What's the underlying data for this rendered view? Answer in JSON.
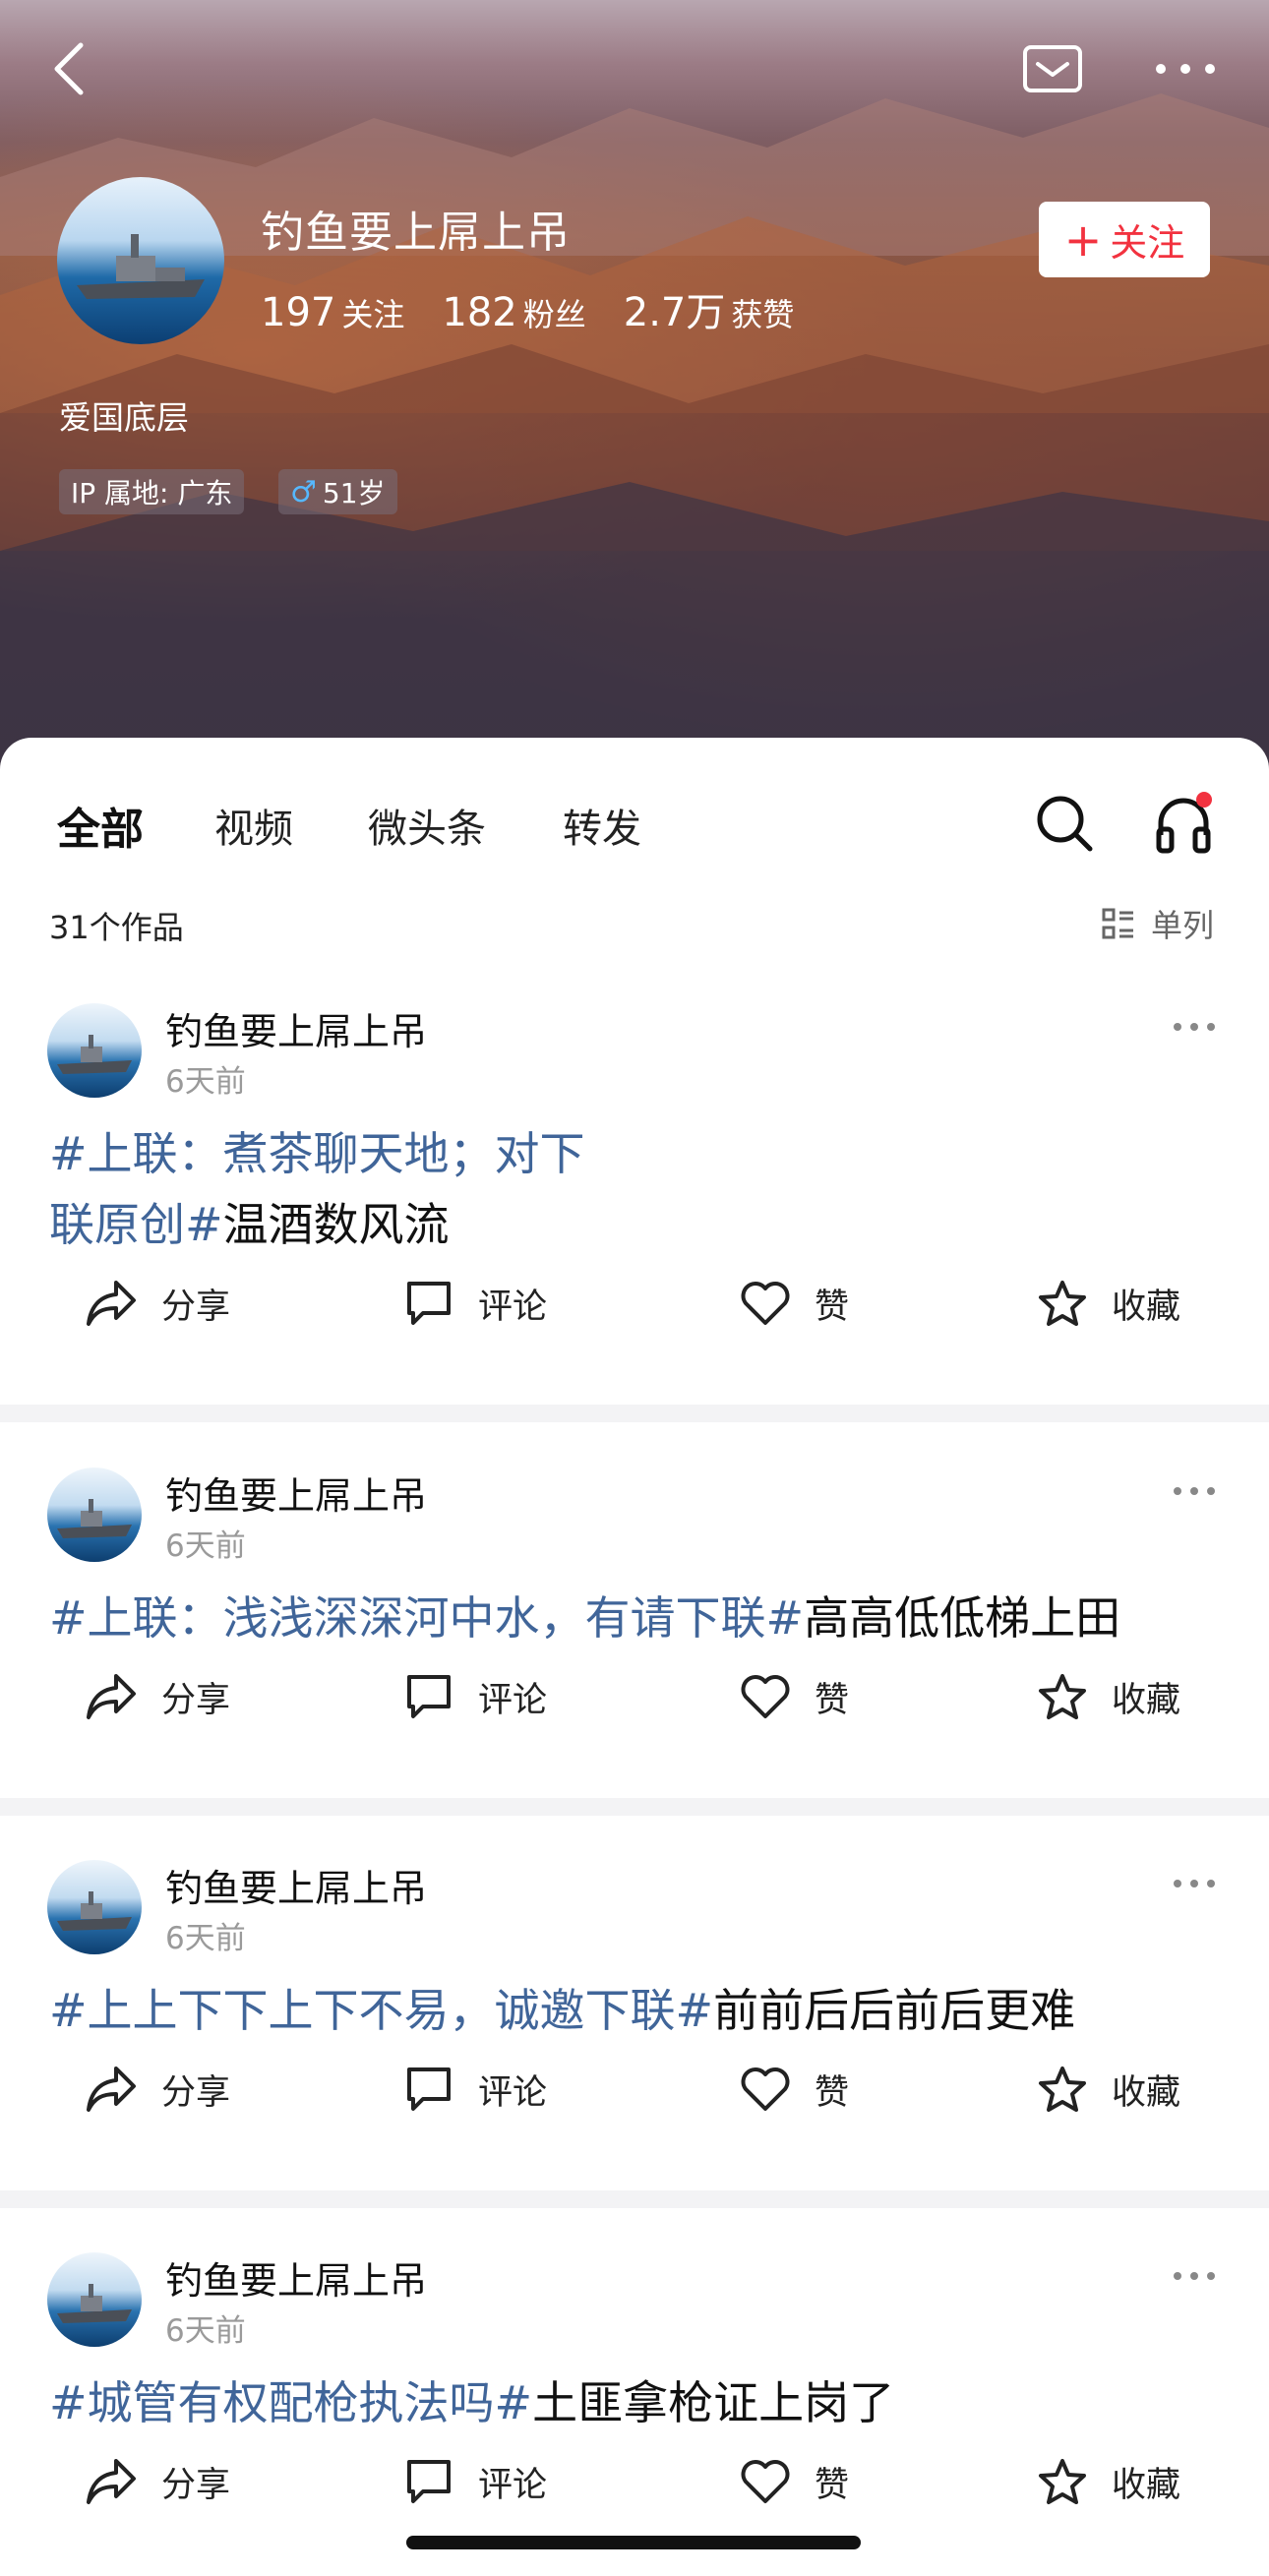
{
  "header": {
    "username": "钓鱼要上屌上吊",
    "stats": [
      {
        "value": "197",
        "label": "关注"
      },
      {
        "value": "182",
        "label": "粉丝"
      },
      {
        "value": "2.7万",
        "label": "获赞"
      }
    ],
    "follow_label": "关注",
    "bio": "爱国底层",
    "ip_tag": "IP 属地: 广东",
    "age_tag": "51岁",
    "icons": {
      "back": "back-chevron-icon",
      "mail": "mail-icon",
      "more": "more-dots-icon"
    }
  },
  "tabs": [
    {
      "label": "全部",
      "active": true
    },
    {
      "label": "视频",
      "active": false
    },
    {
      "label": "微头条",
      "active": false
    },
    {
      "label": "转发",
      "active": false
    }
  ],
  "works_count": "31个作品",
  "layout_toggle_label": "单列",
  "actions": {
    "share": "分享",
    "comment": "评论",
    "like": "赞",
    "favorite": "收藏"
  },
  "posts": [
    {
      "author": "钓鱼要上屌上吊",
      "time": "6天前",
      "hashtag": "#上联：煮茶聊天地；对下联原创#",
      "text": "温酒数风流"
    },
    {
      "author": "钓鱼要上屌上吊",
      "time": "6天前",
      "hashtag": "#上联：浅浅深深河中水，有请下联#",
      "text": "高高低低梯上田"
    },
    {
      "author": "钓鱼要上屌上吊",
      "time": "6天前",
      "hashtag": "#上上下下上下不易，诚邀下联#",
      "text": "前前后后前后更难"
    },
    {
      "author": "钓鱼要上屌上吊",
      "time": "6天前",
      "hashtag": "#城管有权配枪执法吗#",
      "text": "土匪拿枪证上岗了"
    }
  ],
  "colors": {
    "hashtag": "#406599",
    "follow_red": "#f2323f",
    "notice_dot": "#f2323f"
  }
}
